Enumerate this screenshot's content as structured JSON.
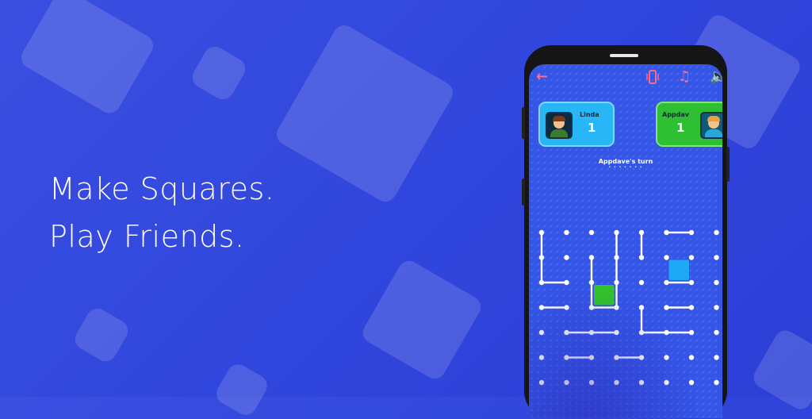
{
  "promo": {
    "line1": "Make Squares.",
    "line2": "Play Friends."
  },
  "colors": {
    "background": "#3146dc",
    "player1": "#29b6f6",
    "player2": "#2fbf32",
    "box_green": "#33c627",
    "box_blue": "#1ea8f5",
    "icon": "#ff6b8a"
  },
  "top_bar": {
    "back_icon": "←",
    "vibrate_icon": "vibrate-icon",
    "music_icon": "♫",
    "sound_icon": "🔈"
  },
  "players": [
    {
      "name": "Linda",
      "score": "1",
      "color": "blue"
    },
    {
      "name": "Appdav",
      "score": "1",
      "color": "green"
    }
  ],
  "turn": {
    "text": "Appdave's turn",
    "dots": "• • • • • • •"
  },
  "board": {
    "rows": 7,
    "cols": 8,
    "h_lines": [
      [
        0,
        5
      ],
      [
        2,
        0
      ],
      [
        2,
        5
      ],
      [
        3,
        0
      ],
      [
        3,
        2
      ],
      [
        3,
        5
      ],
      [
        4,
        1
      ],
      [
        4,
        2
      ],
      [
        4,
        4
      ],
      [
        4,
        5
      ],
      [
        5,
        1
      ],
      [
        5,
        3
      ]
    ],
    "v_lines": [
      [
        0,
        0
      ],
      [
        0,
        3
      ],
      [
        0,
        4
      ],
      [
        1,
        0
      ],
      [
        1,
        2
      ],
      [
        1,
        3
      ],
      [
        2,
        2
      ],
      [
        2,
        3
      ],
      [
        3,
        4
      ]
    ],
    "boxes": [
      {
        "row": 1,
        "col": 5,
        "owner": "blue"
      },
      {
        "row": 2,
        "col": 2,
        "owner": "green"
      }
    ]
  }
}
